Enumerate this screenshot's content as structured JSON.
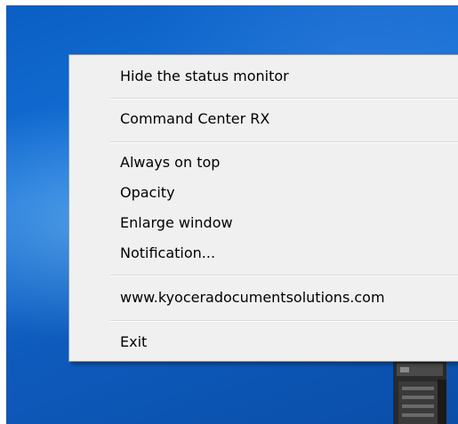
{
  "context_menu": {
    "items": [
      {
        "label": "Hide the status monitor"
      },
      {
        "label": "Command Center RX"
      },
      {
        "label": "Always on top"
      },
      {
        "label": "Opacity"
      },
      {
        "label": "Enlarge window"
      },
      {
        "label": "Notification..."
      },
      {
        "label": "www.kyoceradocumentsolutions.com"
      },
      {
        "label": "Exit"
      }
    ]
  },
  "desktop": {
    "background_color": "#0a5fc4",
    "icon": "printer-icon"
  }
}
